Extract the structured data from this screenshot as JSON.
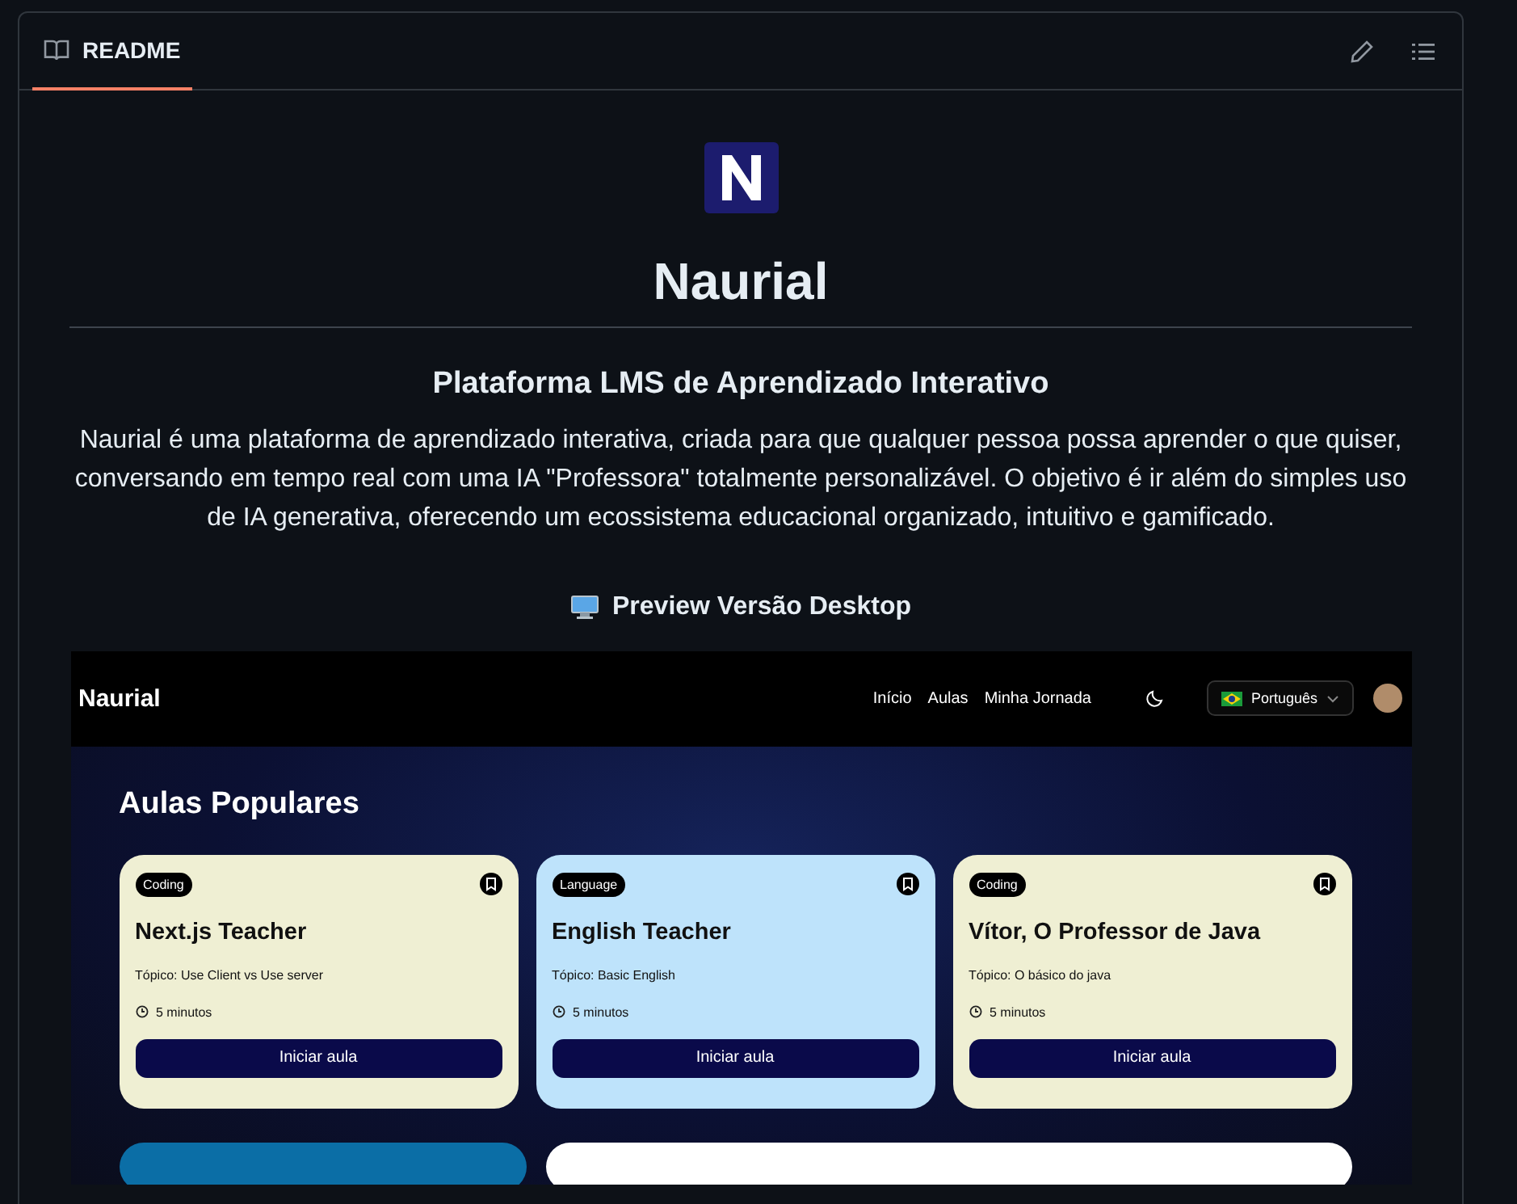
{
  "readme": {
    "tab": {
      "label": "README",
      "selected": true
    }
  },
  "title": "Naurial",
  "subtitle": "Plataforma LMS de Aprendizado Interativo",
  "description": "Naurial é uma plataforma de aprendizado interativa, criada para que qualquer pessoa possa aprender o que quiser, conversando em tempo real com uma IA \"Professora\" totalmente personalizável. O objetivo é ir além do simples uso de IA generativa, oferecendo um ecossistema educacional organizado, intuitivo e gamificado.",
  "preview_heading": "Preview Versão Desktop",
  "preview": {
    "brand": "Naurial",
    "nav": [
      "Início",
      "Aulas",
      "Minha Jornada"
    ],
    "language": "Português",
    "section_title": "Aulas Populares",
    "cards": [
      {
        "tag": "Coding",
        "title": "Next.js Teacher",
        "topic": "Tópico: Use Client vs Use server",
        "duration": "5 minutos",
        "button": "Iniciar aula",
        "color": "#efefd3"
      },
      {
        "tag": "Language",
        "title": "English Teacher",
        "topic": "Tópico: Basic English",
        "duration": "5 minutos",
        "button": "Iniciar aula",
        "color": "#bee3fb"
      },
      {
        "tag": "Coding",
        "title": "Vítor, O Professor de Java",
        "topic": "Tópico: O básico do java",
        "duration": "5 minutos",
        "button": "Iniciar aula",
        "color": "#efefd3"
      }
    ],
    "more_cards": [
      {
        "color": "#0b6ea6"
      },
      {
        "color": "#ffffff"
      }
    ]
  }
}
